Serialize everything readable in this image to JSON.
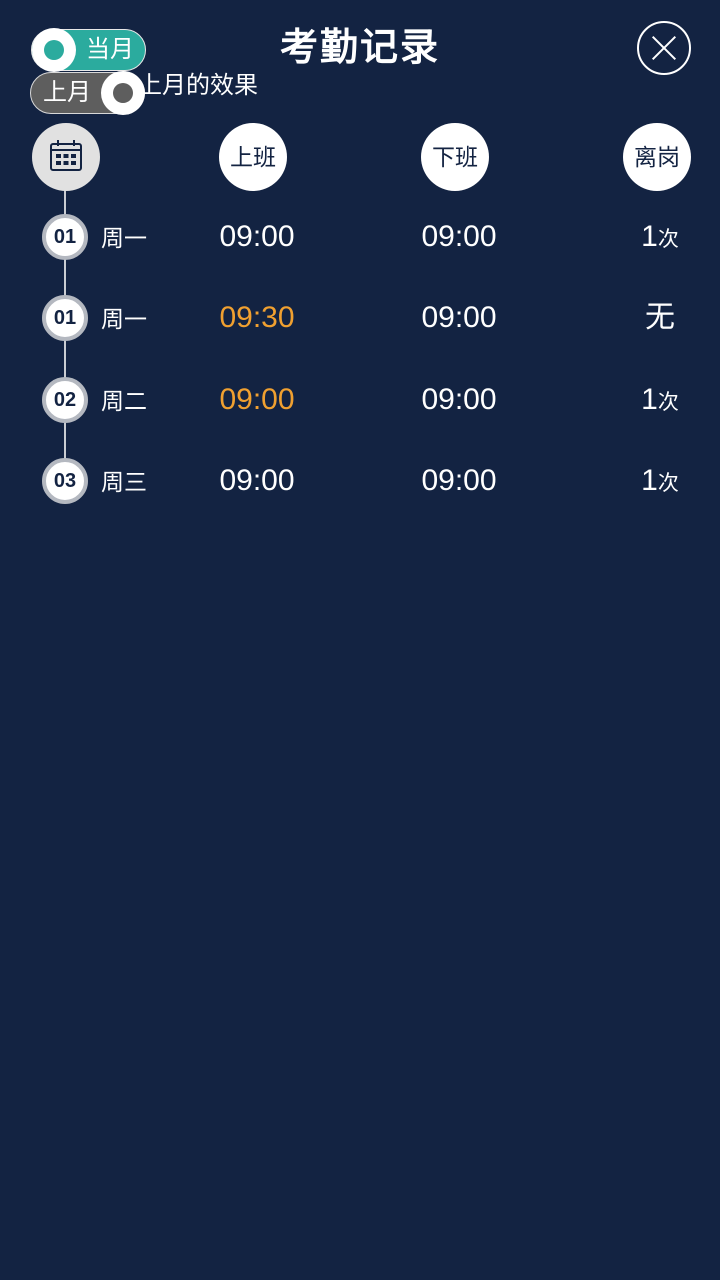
{
  "header": {
    "title": "考勤记录"
  },
  "toggles": {
    "current_month_label": "当月",
    "last_month_label": "上月",
    "caption": "上月的效果"
  },
  "columns": {
    "clock_in": "上班",
    "clock_out": "下班",
    "leave": "离岗"
  },
  "colors": {
    "background": "#132342",
    "accent_teal": "#2bab9e",
    "late_orange": "#f0a030"
  },
  "icons": {
    "calendar": "calendar-icon",
    "close": "close-icon"
  },
  "records": [
    {
      "day": "01",
      "weekday": "周一",
      "clock_in": "09:00",
      "clock_out": "09:00",
      "leave_count": "1",
      "leave_unit": "次",
      "leave_none": "",
      "late": false
    },
    {
      "day": "01",
      "weekday": "周一",
      "clock_in": "09:30",
      "clock_out": "09:00",
      "leave_count": "",
      "leave_unit": "",
      "leave_none": "无",
      "late": true
    },
    {
      "day": "02",
      "weekday": "周二",
      "clock_in": "09:00",
      "clock_out": "09:00",
      "leave_count": "1",
      "leave_unit": "次",
      "leave_none": "",
      "late": true
    },
    {
      "day": "03",
      "weekday": "周三",
      "clock_in": "09:00",
      "clock_out": "09:00",
      "leave_count": "1",
      "leave_unit": "次",
      "leave_none": "",
      "late": false
    }
  ]
}
